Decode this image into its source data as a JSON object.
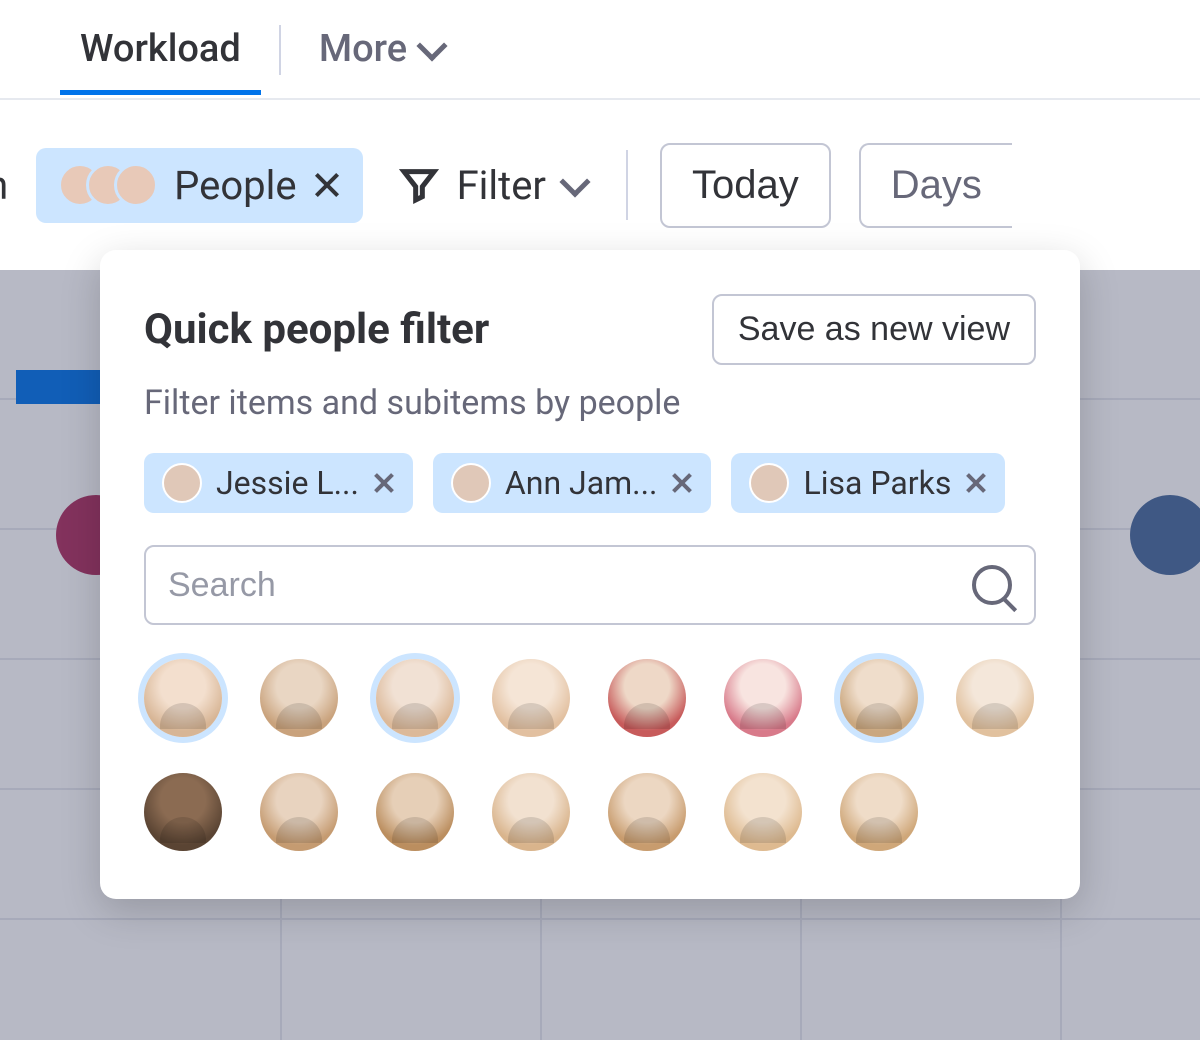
{
  "tabs": {
    "workload": "Workload",
    "more": "More"
  },
  "toolbar": {
    "search_fragment": "rch",
    "people_label": "People",
    "filter_label": "Filter",
    "today_label": "Today",
    "days_label": "Days"
  },
  "popover": {
    "title": "Quick people filter",
    "subtitle": "Filter items and subitems by people",
    "save_button": "Save as new view",
    "search_placeholder": "Search",
    "selected_people": [
      {
        "name": "Jessie L..."
      },
      {
        "name": "Ann Jam..."
      },
      {
        "name": "Lisa Parks"
      }
    ],
    "people": [
      {
        "id": "p0",
        "selected": true
      },
      {
        "id": "p1",
        "selected": false
      },
      {
        "id": "p2",
        "selected": true
      },
      {
        "id": "p3",
        "selected": false
      },
      {
        "id": "p4",
        "selected": false
      },
      {
        "id": "p5",
        "selected": false
      },
      {
        "id": "p6",
        "selected": true
      },
      {
        "id": "p7",
        "selected": false
      },
      {
        "id": "p8",
        "selected": false
      },
      {
        "id": "p9",
        "selected": false
      },
      {
        "id": "p10",
        "selected": false
      },
      {
        "id": "p11",
        "selected": false
      },
      {
        "id": "p12",
        "selected": false
      },
      {
        "id": "p13",
        "selected": false
      },
      {
        "id": "p14",
        "selected": false
      }
    ]
  }
}
